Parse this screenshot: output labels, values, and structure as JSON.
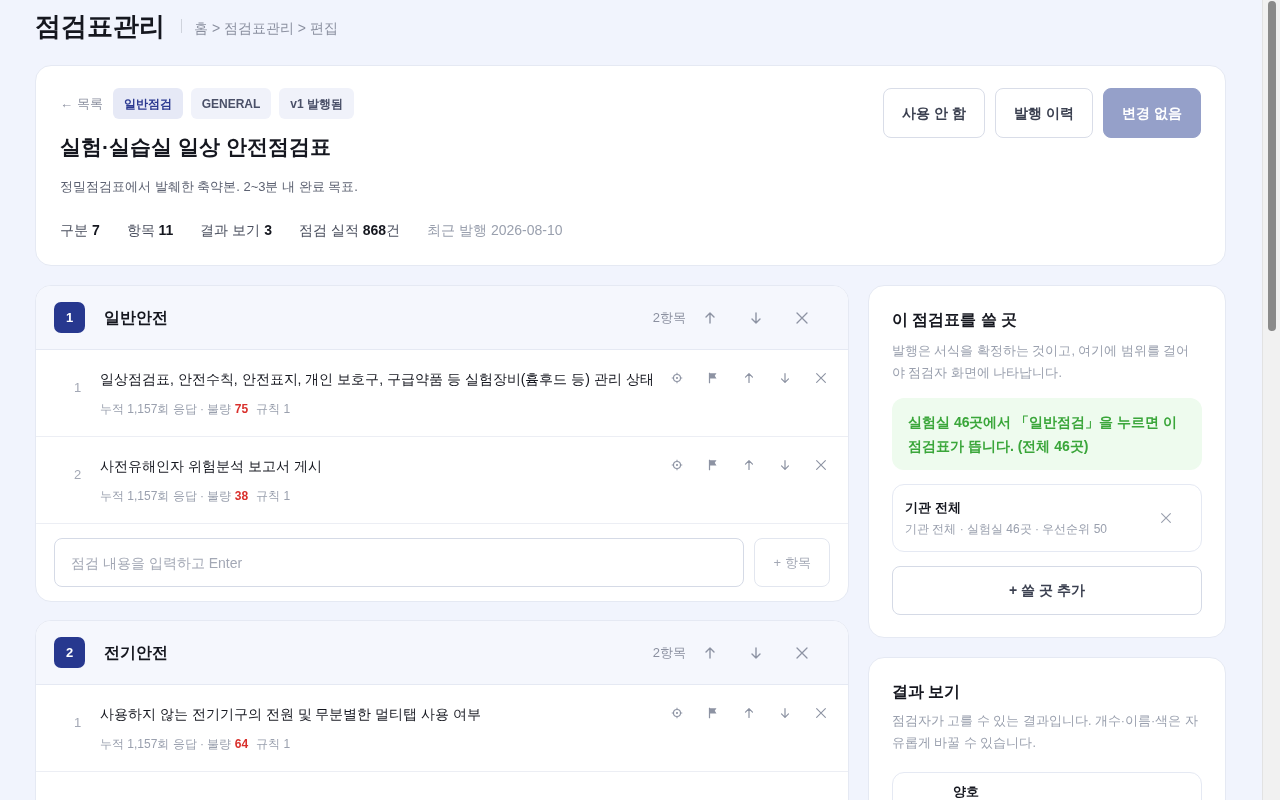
{
  "page_title": "점검표관리",
  "breadcrumb": "홈 > 점검표관리 > 편집",
  "header": {
    "back_link": "← 목록",
    "tags": [
      {
        "label": "일반점검",
        "kind": "primary"
      },
      {
        "label": "GENERAL",
        "kind": "plain"
      },
      {
        "label": "v1 발행됨",
        "kind": "plain"
      }
    ],
    "title": "실험·실습실 일상 안전점검표",
    "description": "정밀점검표에서 발췌한 축약본. 2~3분 내 완료 목표.",
    "stats": [
      {
        "label": "구분",
        "value": "7"
      },
      {
        "label": "항목",
        "value": "11"
      },
      {
        "label": "결과 보기",
        "value": "3"
      },
      {
        "label": "점검 실적",
        "value": "868",
        "unit": "건"
      },
      {
        "label": "최근 발행",
        "value": "2026-08-10",
        "kind": "muted"
      }
    ],
    "buttons": [
      {
        "label": "사용 안 함",
        "disabled": false
      },
      {
        "label": "발행 이력",
        "disabled": false
      },
      {
        "label": "변경 없음",
        "disabled": true
      }
    ]
  },
  "sections": [
    {
      "number": "1",
      "title": "일반안전",
      "count": "2항목",
      "items": [
        {
          "number": "1",
          "text": "일상점검표, 안전수칙, 안전표지, 개인 보호구, 구급약품 등 실험장비(흄후드 등) 관리 상태",
          "stats": "누적 1,157회 응답 · 불량",
          "defects": "75",
          "rules": "규칙 1"
        },
        {
          "number": "2",
          "text": "사전유해인자 위험분석 보고서 게시",
          "stats": "누적 1,157회 응답 · 불량",
          "defects": "38",
          "rules": "규칙 1"
        }
      ],
      "input": {
        "placeholder": "점검 내용을 입력하고 Enter"
      },
      "add_button": "+ 항목"
    },
    {
      "number": "2",
      "title": "전기안전",
      "count": "2항목",
      "items": [
        {
          "number": "1",
          "text": "사용하지 않는 전기기구의 전원 및 무분별한 멀티탭 사용 여부",
          "stats": "누적 1,157회 응답 · 불량",
          "defects": "64",
          "rules": "규칙 1"
        }
      ]
    }
  ],
  "usage_panel": {
    "title": "이 점검표를 쓸 곳",
    "description": "발행은 서식을 확정하는 것이고, 여기에 범위를 걸어야 점검자 화면에 나타납니다.",
    "notice": "실험실 **46곳**에서 「일반점검」을 누르면 이 점검표가 뜹니다. (전체 46곳)",
    "scopes": [
      {
        "title": "기관 전체",
        "detail": "기관 전체 · 실험실 46곳 · 우선순위 50"
      }
    ],
    "add_button": "+ 쓸 곳 추가"
  },
  "results_panel": {
    "title": "결과 보기",
    "description": "점검자가 고를 수 있는 결과입니다. 개수·이름·색은 자유롭게 바꿀 수 있습니다.",
    "results": [
      {
        "label": "양호"
      }
    ]
  }
}
